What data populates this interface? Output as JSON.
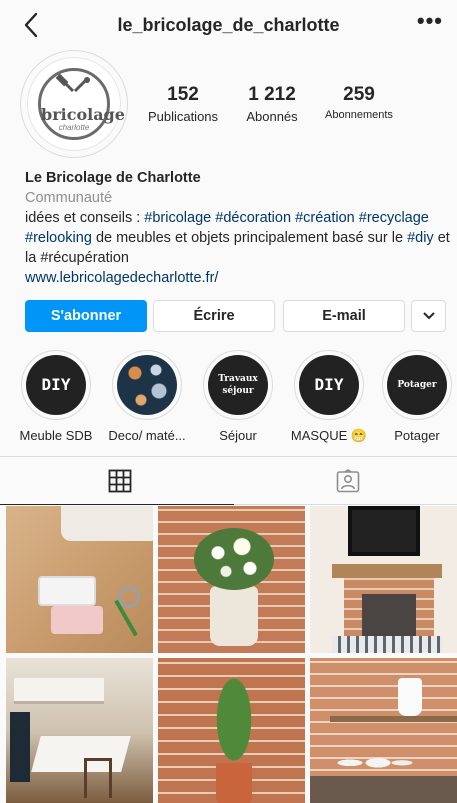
{
  "header": {
    "username": "le_bricolage_de_charlotte"
  },
  "profile": {
    "logo_text": "bricolage",
    "logo_sub": "charlotte",
    "stats": [
      {
        "value": "152",
        "label": "Publications"
      },
      {
        "value": "1 212",
        "label": "Abonnés"
      },
      {
        "value": "259",
        "label": "Abonnements"
      }
    ]
  },
  "bio": {
    "name": "Le Bricolage de Charlotte",
    "category": "Communauté",
    "line1_prefix": "idées et conseils : ",
    "tag_bricolage": "#bricolage",
    "tag_decoration": "#décoration",
    "tag_creation": "#création",
    "tag_recyclage": "#recyclage",
    "tag_relooking": "#relooking",
    "line2_text": " de meubles et objets principalement basé sur le ",
    "tag_diy": "#diy",
    "line3_text": " et la #récupération",
    "website": "www.lebricolagedecharlotte.fr/"
  },
  "buttons": {
    "follow": "S'abonner",
    "message": "Écrire",
    "email": "E-mail"
  },
  "highlights": [
    {
      "label": "Meuble SDB",
      "cover": "DIY"
    },
    {
      "label": "Deco/ maté...",
      "cover": ""
    },
    {
      "label": "Séjour",
      "cover_line1": "Travaux",
      "cover_line2": "séjour"
    },
    {
      "label": "MASQUE 😁",
      "cover": "DIY"
    },
    {
      "label": "Potager",
      "cover": "Potager"
    }
  ],
  "tabs": {
    "grid_icon": "grid-icon",
    "tagged_icon": "tagged-person-icon"
  },
  "colors": {
    "accent": "#0095f6",
    "link": "#00376b",
    "muted": "#8e8e8e"
  }
}
